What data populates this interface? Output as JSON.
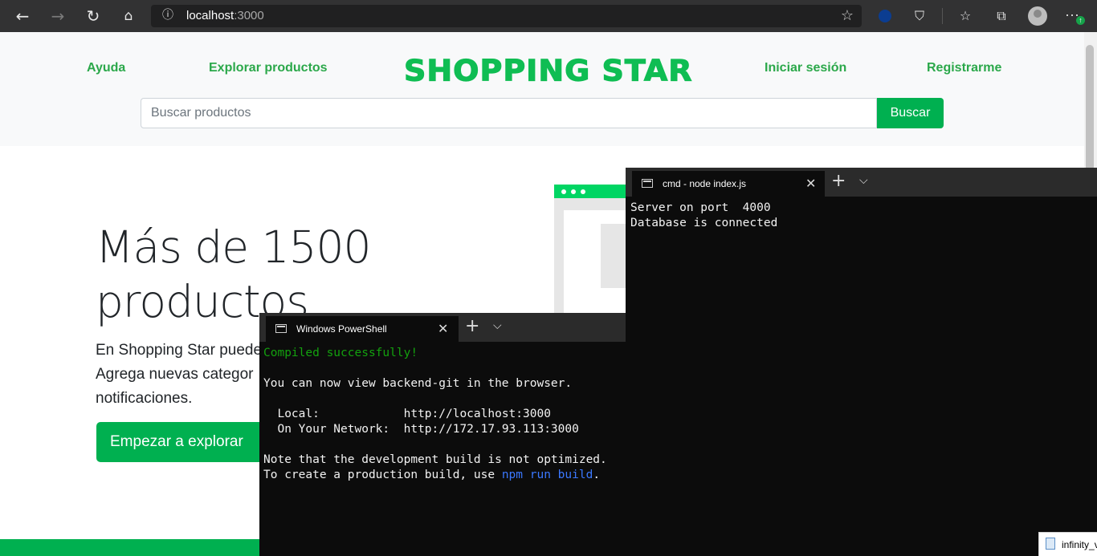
{
  "browser": {
    "back_icon": "arrow-left-icon",
    "forward_icon": "arrow-right-icon",
    "reload_icon": "reload-icon",
    "home_icon": "home-icon",
    "url_host": "localhost",
    "url_port": ":3000",
    "icons": [
      "info-icon",
      "star-icon",
      "nasa-extension-icon",
      "pocket-icon",
      "favorites-icon",
      "collections-icon",
      "profile-avatar",
      "more-icon"
    ]
  },
  "header": {
    "nav_help": "Ayuda",
    "nav_explore": "Explorar productos",
    "logo": "SHOPPING STAR",
    "nav_login": "Iniciar sesión",
    "nav_register": "Registrarme",
    "search_placeholder": "Buscar productos",
    "search_button": "Buscar"
  },
  "hero": {
    "title_line1": "Más de 1500",
    "title_line2": "productos",
    "text_line1": "En Shopping Star puede",
    "text_line2": "Agrega nuevas categor",
    "text_line3": "notificaciones.",
    "cta": "Empezar a explorar"
  },
  "powershell": {
    "tab_title": "Windows PowerShell",
    "compiled": "Compiled successfully!",
    "view_line": "You can now view backend-git in the browser.",
    "local_label": "  Local:            ",
    "local_url": "http://localhost:3000",
    "network_label": "  On Your Network:  ",
    "network_url": "http://172.17.93.113:3000",
    "note_line": "Note that the development build is not optimized.",
    "prod_prefix": "To create a production build, use ",
    "prod_cmd": "npm run build",
    "prod_suffix": "."
  },
  "cmd": {
    "tab_title": "cmd - node  index.js",
    "line1": "Server on port  4000",
    "line2": "Database is connected"
  },
  "taskbar": {
    "item_label": "infinity_v"
  },
  "colors": {
    "brand_green": "#00b050",
    "nav_green": "#2ba84a",
    "terminal_green": "#13a10e",
    "terminal_blue": "#3b78ff"
  }
}
